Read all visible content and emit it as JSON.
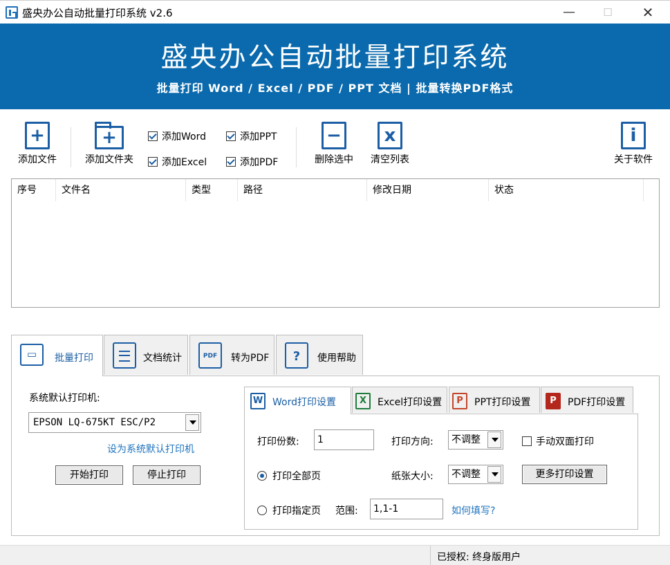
{
  "window": {
    "title": "盛央办公自动批量打印系统 v2.6",
    "minimize": "—",
    "maximize": "☐",
    "close": "✕"
  },
  "banner": {
    "title": "盛央办公自动批量打印系统",
    "subtitle": "批量打印 Word / Excel / PDF / PPT 文档 | 批量转换PDF格式",
    "bg_color": "#0a6aad"
  },
  "toolbar": {
    "add_file": "添加文件",
    "add_folder": "添加文件夹",
    "add_word": "添加Word",
    "add_ppt": "添加PPT",
    "add_excel": "添加Excel",
    "add_pdf": "添加PDF",
    "delete_selected": "删除选中",
    "clear_list": "清空列表",
    "about": "关于软件",
    "icons": {
      "add_file": "file-plus-icon",
      "add_folder": "folder-plus-icon",
      "delete": "file-minus-icon",
      "clear": "file-x-icon",
      "about": "info-icon"
    }
  },
  "file_list": {
    "columns": [
      "序号",
      "文件名",
      "类型",
      "路径",
      "修改日期",
      "状态"
    ],
    "rows": []
  },
  "main_tabs": {
    "batch_print": "批量打印",
    "doc_stats": "文档统计",
    "to_pdf": "转为PDF",
    "pdf_badge": "PDF",
    "help": "使用帮助",
    "help_glyph": "?"
  },
  "printer": {
    "label": "系统默认打印机:",
    "selected": "EPSON LQ-675KT ESC/P2",
    "set_default_link": "设为系统默认打印机",
    "start": "开始打印",
    "stop": "停止打印"
  },
  "sub_tabs": {
    "word": "Word打印设置",
    "excel": "Excel打印设置",
    "ppt": "PPT打印设置",
    "pdf": "PDF打印设置",
    "word_glyph": "W",
    "excel_glyph": "X",
    "ppt_glyph": "P",
    "pdf_glyph": "P"
  },
  "word_settings": {
    "copies_label": "打印份数:",
    "copies_value": "1",
    "orientation_label": "打印方向:",
    "orientation_value": "不调整",
    "duplex_label": "手动双面打印",
    "print_all_label": "打印全部页",
    "paper_label": "纸张大小:",
    "paper_value": "不调整",
    "more_settings": "更多打印设置",
    "print_range_label": "打印指定页",
    "range_label": "范围:",
    "range_value": "1,1-1",
    "how_link": "如何填写?"
  },
  "status": {
    "license": "已授权: 终身版用户"
  }
}
